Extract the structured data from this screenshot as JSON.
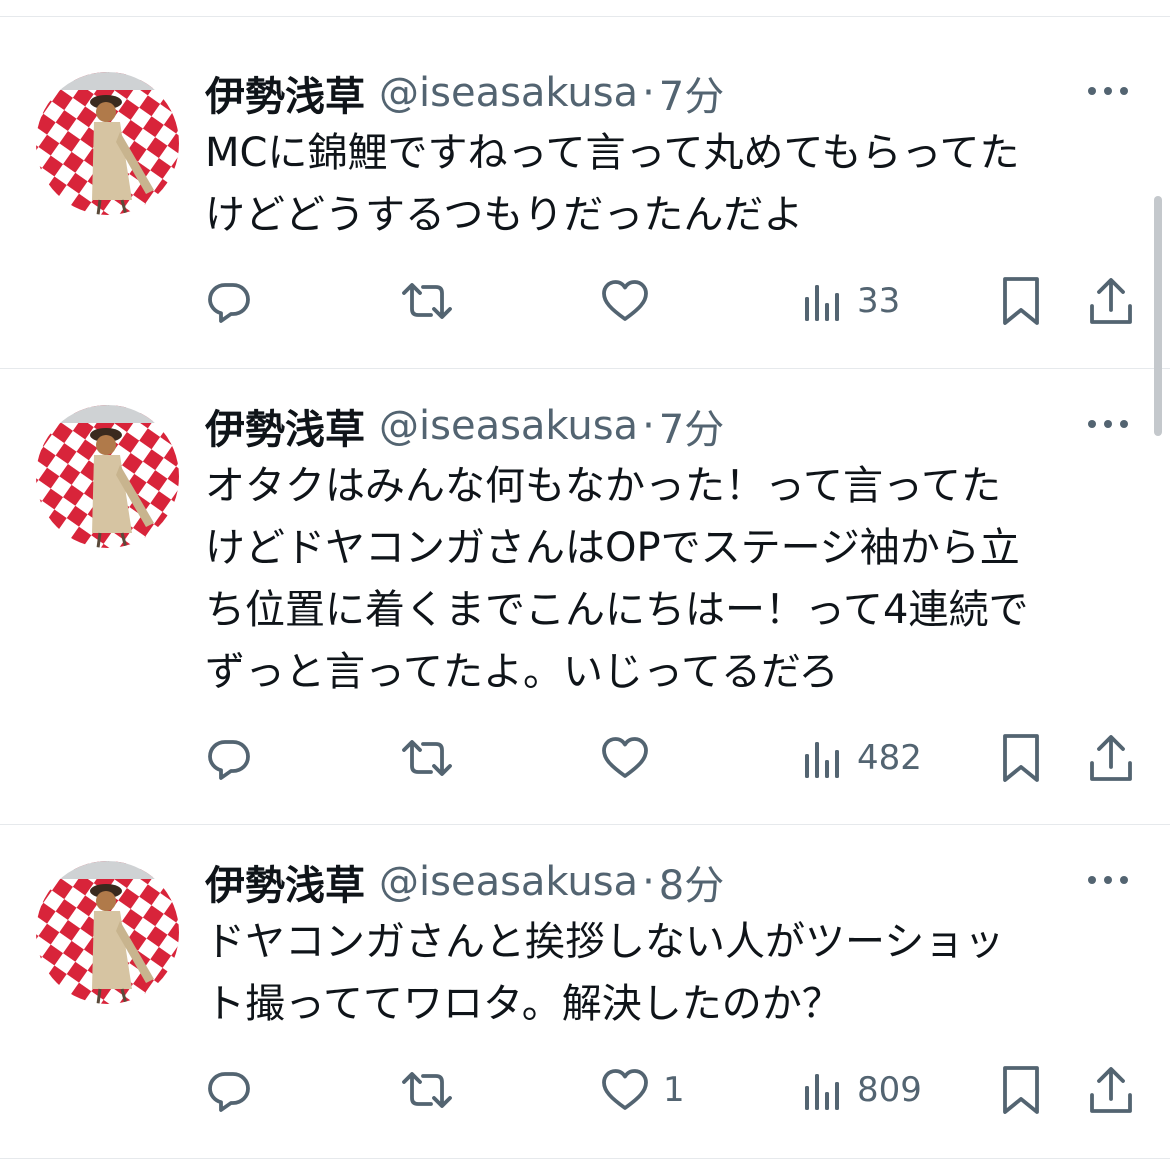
{
  "colors": {
    "text": "#0f1419",
    "secondary": "#536471",
    "divider": "#e6e9ec",
    "avatar_red": "#d8243a"
  },
  "icons": {
    "more": "more-horizontal-icon",
    "reply": "reply-icon",
    "retweet": "retweet-icon",
    "like": "heart-icon",
    "views": "analytics-icon",
    "bookmark": "bookmark-icon",
    "share": "share-icon"
  },
  "tweets": [
    {
      "name": "伊勢浅草",
      "handle": "@iseasakusa",
      "separator": "·",
      "time": "7分",
      "text": "MCに錦鯉ですねって言って丸めてもらってた\nけどどうするつもりだったんだよ",
      "replies": "",
      "retweets": "",
      "likes": "",
      "views": "33"
    },
    {
      "name": "伊勢浅草",
      "handle": "@iseasakusa",
      "separator": "·",
      "time": "7分",
      "text": "オタクはみんな何もなかった！って言ってた\nけどドヤコンガさんはOPでステージ袖から立\nち位置に着くまでこんにちはー！って4連続で\nずっと言ってたよ。いじってるだろ",
      "replies": "",
      "retweets": "",
      "likes": "",
      "views": "482"
    },
    {
      "name": "伊勢浅草",
      "handle": "@iseasakusa",
      "separator": "·",
      "time": "8分",
      "text": "ドヤコンガさんと挨拶しない人がツーショッ\nト撮っててワロタ。解決したのか？",
      "replies": "",
      "retweets": "",
      "likes": "1",
      "views": "809"
    }
  ]
}
